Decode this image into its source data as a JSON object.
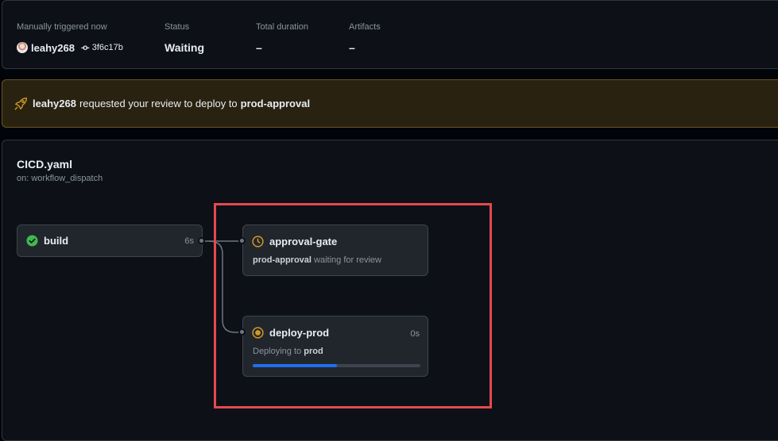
{
  "summary": {
    "trigger_label": "Manually triggered now",
    "user": "leahy268",
    "commit_sha": "3f6c17b",
    "status_label": "Status",
    "status_value": "Waiting",
    "duration_label": "Total duration",
    "duration_value": "–",
    "artifacts_label": "Artifacts",
    "artifacts_value": "–"
  },
  "banner": {
    "user": "leahy268",
    "text": "requested your review to deploy to",
    "environment": "prod-approval",
    "icon": "rocket-icon",
    "color": "#d29922"
  },
  "workflow": {
    "file": "CICD.yaml",
    "trigger": "on: workflow_dispatch"
  },
  "jobs": {
    "build": {
      "name": "build",
      "duration": "6s",
      "status": "success",
      "icon": "check-circle-icon"
    },
    "approval_gate": {
      "name": "approval-gate",
      "status": "waiting",
      "icon": "clock-icon",
      "env": "prod-approval",
      "sub_text": "waiting for review"
    },
    "deploy_prod": {
      "name": "deploy-prod",
      "duration": "0s",
      "status": "in_progress",
      "icon": "in-progress-icon",
      "sub_prefix": "Deploying to",
      "env": "prod",
      "progress": 0.5
    }
  },
  "colors": {
    "success": "#3fb950",
    "waiting": "#d29922",
    "progress": "#1f6feb",
    "highlight": "#e5484d"
  }
}
